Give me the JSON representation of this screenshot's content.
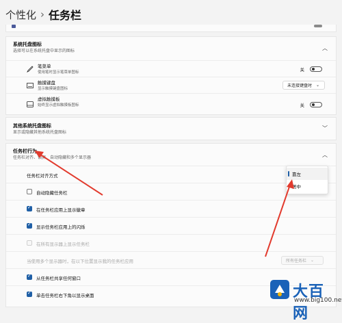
{
  "breadcrumb": {
    "parent": "个性化",
    "separator": "›",
    "current": "任务栏"
  },
  "tray_section": {
    "title": "系统托盘图标",
    "subtitle": "选择可以在系统托盘中显示的图标",
    "items": [
      {
        "label": "笔菜单",
        "sub": "使用笔时显示笔菜单图标",
        "icon": "pen-icon",
        "control": "toggle",
        "state": "关"
      },
      {
        "label": "触摸键盘",
        "sub": "显示触摸键盘图标",
        "icon": "keyboard-icon",
        "control": "select",
        "value": "未连接键盘时"
      },
      {
        "label": "虚拟触摸板",
        "sub": "始终显示虚拟触摸板图标",
        "icon": "touchpad-icon",
        "control": "toggle",
        "state": "关"
      }
    ]
  },
  "other_tray": {
    "title": "其他系统托盘图标",
    "subtitle": "显示或隐藏其他系统托盘图标"
  },
  "behaviors": {
    "title": "任务栏行为",
    "subtitle": "任务栏对齐、锁屏、自动隐藏和多个显示器",
    "alignment_label": "任务栏对齐方式",
    "alignment_options": [
      "靠左",
      "居中"
    ],
    "items": [
      {
        "label": "自动隐藏任务栏",
        "state": "unchecked"
      },
      {
        "label": "在任务栏应用上显示徽章",
        "state": "checked"
      },
      {
        "label": "显示任务栏应用上的闪烁",
        "state": "checked"
      },
      {
        "label": "在所有显示器上显示任务栏",
        "state": "disabled"
      }
    ],
    "multi_display_label": "当使用多个显示器时，在以下位置显示我的任务栏应用",
    "multi_display_value": "所有任务栏",
    "items_after": [
      {
        "label": "从任务栏共享任何窗口",
        "state": "checked"
      },
      {
        "label": "单击任务栏右下角以显示桌面",
        "state": "checked"
      }
    ]
  },
  "watermark": {
    "brand": "大百网",
    "url": "www.big100.net"
  },
  "colors": {
    "accent": "#1f5fa6",
    "arrow": "#e23b2e",
    "background": "#f3f3f3"
  }
}
